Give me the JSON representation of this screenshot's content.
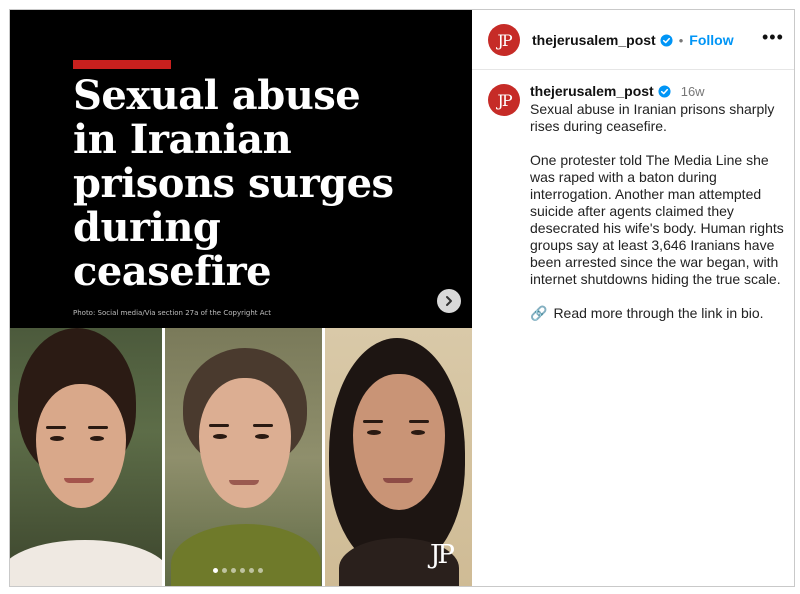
{
  "media": {
    "headline": "Sexual abuse\nin Iranian\nprisons surges\nduring\nceasefire",
    "photo_credit": "Photo: Social media/Via section 27a of the Copyright Act",
    "watermark": "JP",
    "carousel": {
      "total": 6,
      "active_index": 0
    }
  },
  "header": {
    "avatar_text": "JP",
    "username": "thejerusalem_post",
    "separator": "•",
    "follow_label": "Follow",
    "more_label": "•••"
  },
  "post": {
    "avatar_text": "JP",
    "username": "thejerusalem_post",
    "age": "16w",
    "paragraph_1": "Sexual abuse in Iranian prisons sharply rises during ceasefire.",
    "paragraph_2": "One protester told The Media Line she was raped with a baton during interrogation. Another man attempted suicide after agents claimed they desecrated his wife's body. Human rights groups say at least 3,646 Iranians have been arrested since the war began, with internet shutdowns hiding the true scale.",
    "link_icon": "🔗",
    "link_text": "Read more through the link in bio."
  },
  "colors": {
    "brand_red": "#c62b27",
    "headline_bar": "#c8201e",
    "follow_blue": "#0095f6",
    "verified_blue": "#0095f6"
  },
  "icons": {
    "next": "chevron-right-icon",
    "verified": "verified-badge-icon",
    "more": "more-options-icon",
    "link": "link-icon"
  }
}
